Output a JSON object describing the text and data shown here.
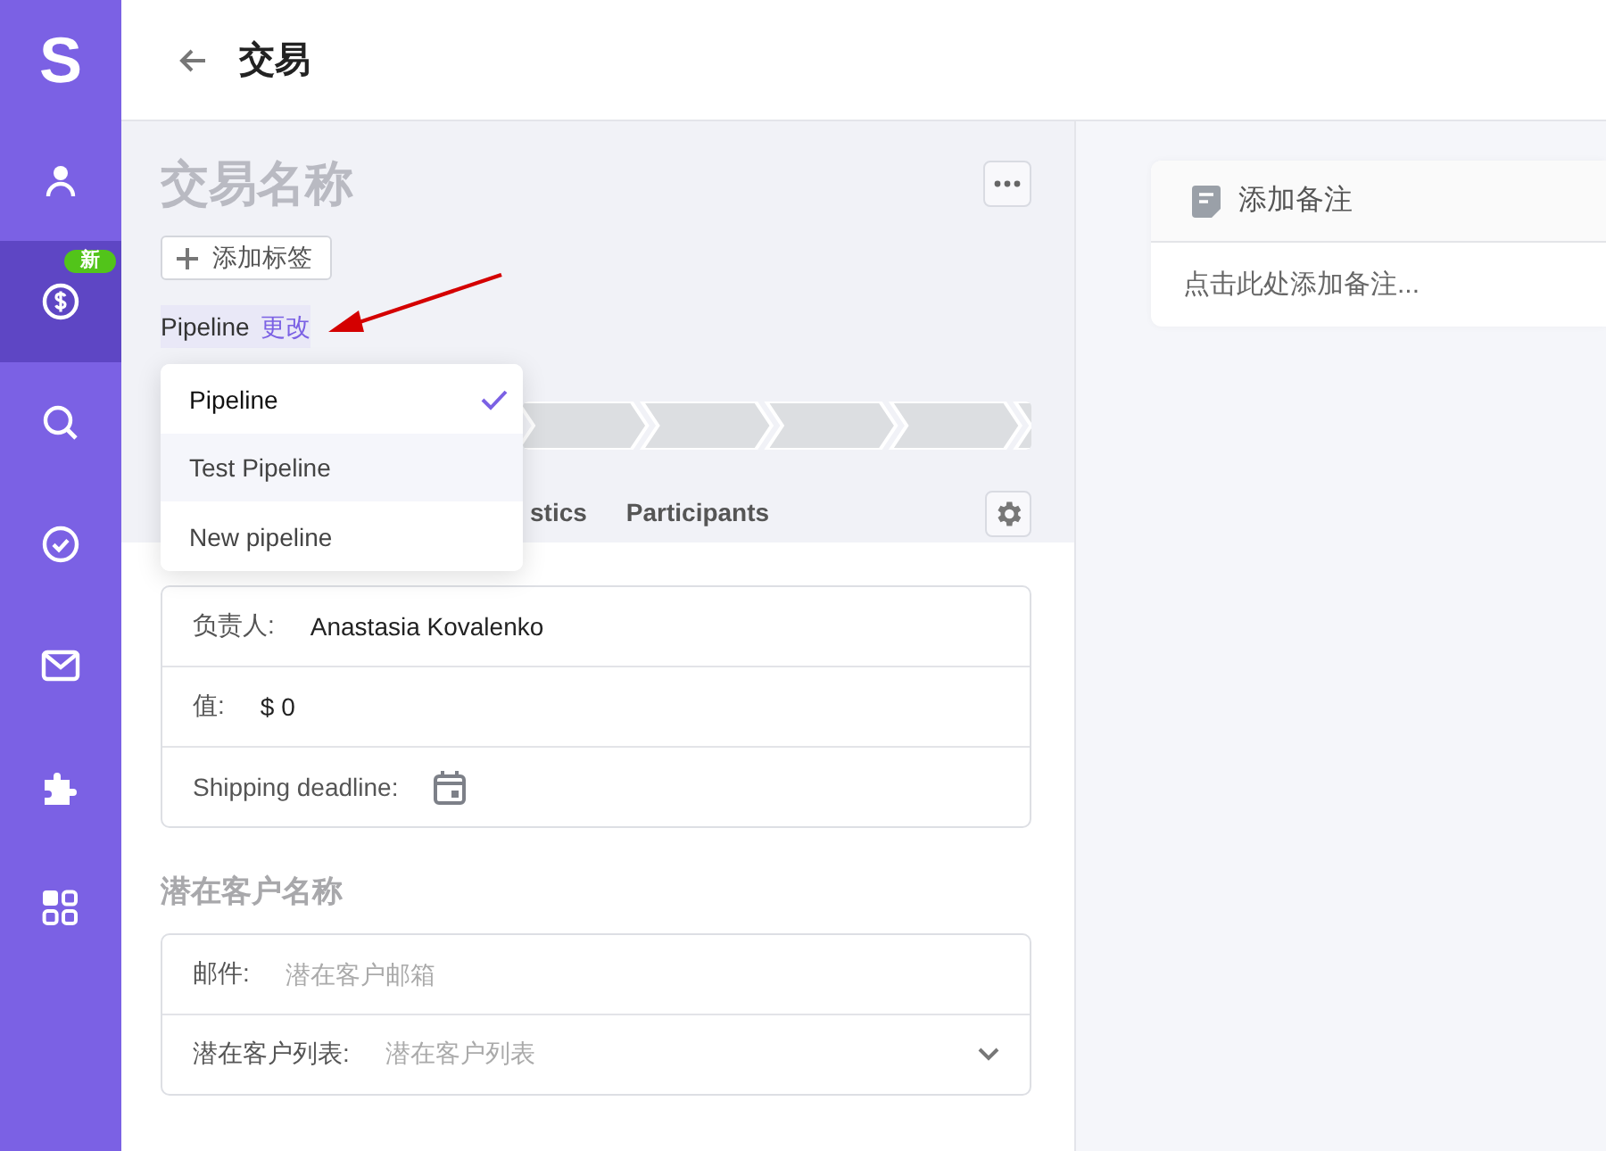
{
  "sidebar": {
    "logo": "S",
    "items": [
      {
        "kind": "contacts",
        "selected": false
      },
      {
        "kind": "deals",
        "selected": true,
        "badge": "新"
      },
      {
        "kind": "search",
        "selected": false
      },
      {
        "kind": "tasks",
        "selected": false
      },
      {
        "kind": "mail",
        "selected": false
      },
      {
        "kind": "integrations",
        "selected": false
      },
      {
        "kind": "apps",
        "selected": false
      }
    ]
  },
  "header": {
    "title": "交易"
  },
  "deal": {
    "name_placeholder": "交易名称",
    "add_tag": "添加标签",
    "pipeline_label": "Pipeline",
    "change_link": "更改",
    "pipeline_menu": [
      {
        "label": "Pipeline",
        "selected": true
      },
      {
        "label": "Test Pipeline",
        "selected": false
      },
      {
        "label": "New pipeline",
        "selected": false
      }
    ],
    "tabs": [
      {
        "label": "stics",
        "selected": false
      },
      {
        "label": "Participants",
        "selected": false
      }
    ],
    "fields": [
      {
        "kind": "text",
        "label": "负责人:",
        "value": "Anastasia Kovalenko"
      },
      {
        "kind": "text",
        "label": "值:",
        "value": "$ 0"
      },
      {
        "kind": "date",
        "label": "Shipping deadline:"
      }
    ],
    "contact": {
      "title": "潜在客户名称",
      "fields": [
        {
          "kind": "input",
          "label": "邮件:",
          "placeholder": "潜在客户邮箱"
        },
        {
          "kind": "select",
          "label": "潜在客户列表:",
          "placeholder": "潜在客户列表"
        }
      ]
    }
  },
  "notes": {
    "title": "添加备注",
    "placeholder": "点击此处添加备注..."
  }
}
